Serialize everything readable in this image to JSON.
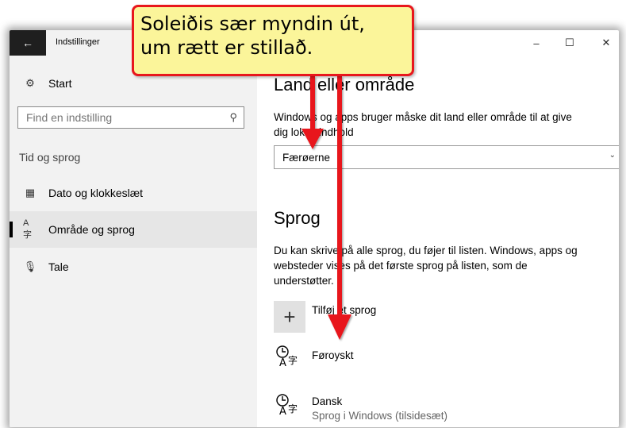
{
  "window": {
    "title": "Indstillinger",
    "back_icon": "back-arrow-icon",
    "controls": {
      "minimize": "–",
      "maximize": "☐",
      "close": "✕"
    }
  },
  "sidebar": {
    "home_label": "Start",
    "search_placeholder": "Find en indstilling",
    "group_label": "Tid og sprog",
    "items": [
      {
        "label": "Dato og klokkeslæt",
        "icon": "calendar-clock-icon",
        "selected": false
      },
      {
        "label": "Område og sprog",
        "icon": "language-icon",
        "selected": true
      },
      {
        "label": "Tale",
        "icon": "microphone-icon",
        "selected": false
      }
    ]
  },
  "main": {
    "region_heading": "Land eller område",
    "region_desc_1": "Windows og apps bruger måske dit land eller område til at give",
    "region_desc_2": "dig lokalt indhold",
    "region_value": "Færøerne",
    "language_heading": "Sprog",
    "language_desc_1": "Du kan skrive på alle sprog, du føjer til listen. Windows, apps og",
    "language_desc_2": "websteder vises på det første sprog på listen, som de",
    "language_desc_3": "understøtter.",
    "add_language_label": "Tilføj et sprog",
    "languages": [
      {
        "name": "Føroyskt",
        "sub": ""
      },
      {
        "name": "Dansk",
        "sub": "Sprog i Windows (tilsidesæt)"
      }
    ]
  },
  "annotation": {
    "line1": "Soleiðis sær myndin út,",
    "line2": "um rætt er stillað.",
    "color": "#e8171d",
    "fill": "#fbf59a"
  }
}
